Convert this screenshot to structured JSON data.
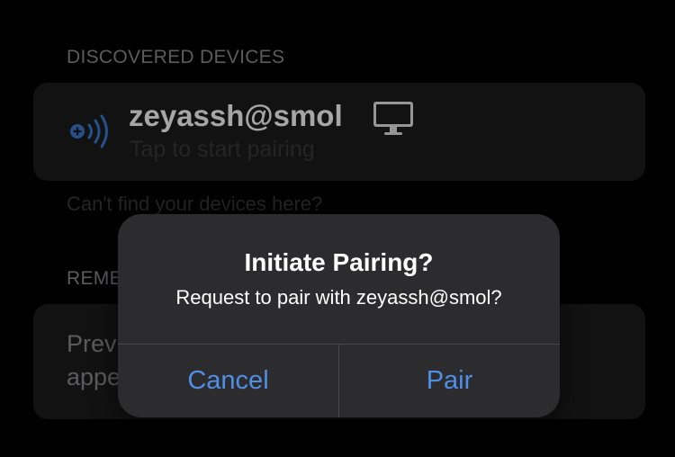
{
  "discovered": {
    "header": "DISCOVERED DEVICES",
    "device": {
      "name": "zeyassh@smol",
      "subtitle": "Tap to start pairing",
      "status_icon": "broadcast-plus-icon",
      "type_icon": "desktop-monitor-icon"
    },
    "help_link": "Can't find your devices here?"
  },
  "remembered": {
    "header": "REME",
    "text_line1": "Prev",
    "text_line2": "appe"
  },
  "alert": {
    "title": "Initiate Pairing?",
    "message": "Request to pair with zeyassh@smol?",
    "cancel_label": "Cancel",
    "pair_label": "Pair"
  },
  "colors": {
    "accent": "#4f8fe6",
    "background": "#000000",
    "card": "#1c1c1e",
    "alert": "#2c2c2e"
  }
}
